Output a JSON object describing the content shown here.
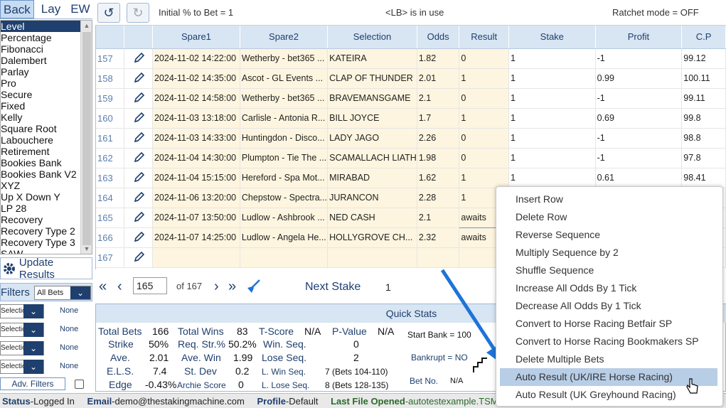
{
  "tabs": {
    "back": "Back",
    "lay": "Lay",
    "ew": "EW"
  },
  "methods": [
    "Level",
    "Percentage",
    "Fibonacci",
    "Dalembert",
    "Parlay",
    "Pro",
    "Secure",
    "Fixed",
    "Kelly",
    "Square Root",
    "Labouchere",
    "Retirement",
    "Bookies Bank",
    "Bookies Bank V2",
    "XYZ",
    "Up X Down Y",
    "LP 28",
    "Recovery",
    "Recovery Type 2",
    "Recovery Type 3",
    "SAW"
  ],
  "update_results": "Update Results",
  "filters": {
    "label": "Filters",
    "select": "All Bets",
    "rows": [
      {
        "sel": "Selection",
        "val": "None"
      },
      {
        "sel": "Selection",
        "val": "None"
      },
      {
        "sel": "Selection",
        "val": "None"
      },
      {
        "sel": "Selection",
        "val": "None"
      }
    ],
    "adv": "Adv. Filters"
  },
  "toolbar": {
    "initial": "Initial % to Bet = 1",
    "lb": "<LB> is in use",
    "ratchet": "Ratchet mode = OFF"
  },
  "grid": {
    "headers": [
      "",
      "",
      "Spare1",
      "Spare2",
      "Selection",
      "Odds",
      "Result",
      "Stake",
      "Profit",
      "C.P"
    ],
    "rows": [
      {
        "n": "157",
        "s1": "2024-11-02 14:22:00",
        "s2": "Wetherby - bet365 ...",
        "sel": "KATEIRA",
        "odds": "1.82",
        "res": "0",
        "stake": "1",
        "profit": "-1",
        "cp": "99.12"
      },
      {
        "n": "158",
        "s1": "2024-11-02 14:35:00",
        "s2": "Ascot - GL Events ...",
        "sel": "CLAP OF THUNDER",
        "odds": "2.01",
        "res": "1",
        "stake": "1",
        "profit": "0.99",
        "cp": "100.11"
      },
      {
        "n": "159",
        "s1": "2024-11-02 14:58:00",
        "s2": "Wetherby - bet365 ...",
        "sel": "BRAVEMANSGAME",
        "odds": "2.1",
        "res": "0",
        "stake": "1",
        "profit": "-1",
        "cp": "99.11"
      },
      {
        "n": "160",
        "s1": "2024-11-03 13:18:00",
        "s2": "Carlisle - Antonia R...",
        "sel": "BILL JOYCE",
        "odds": "1.7",
        "res": "1",
        "stake": "1",
        "profit": "0.69",
        "cp": "99.8"
      },
      {
        "n": "161",
        "s1": "2024-11-03 14:33:00",
        "s2": "Huntingdon - Disco...",
        "sel": "LADY JAGO",
        "odds": "2.26",
        "res": "0",
        "stake": "1",
        "profit": "-1",
        "cp": "98.8"
      },
      {
        "n": "162",
        "s1": "2024-11-04 14:30:00",
        "s2": "Plumpton - Tie The ...",
        "sel": "SCAMALLACH LIATH",
        "odds": "1.98",
        "res": "0",
        "stake": "1",
        "profit": "-1",
        "cp": "97.8"
      },
      {
        "n": "163",
        "s1": "2024-11-04 15:15:00",
        "s2": "Hereford - Spa Mot...",
        "sel": "MIRABAD",
        "odds": "1.62",
        "res": "1",
        "stake": "1",
        "profit": "0.61",
        "cp": "98.41"
      },
      {
        "n": "164",
        "s1": "2024-11-06 13:20:00",
        "s2": "Chepstow - Spectra...",
        "sel": "JURANCON",
        "odds": "2.28",
        "res": "1",
        "stake": "",
        "profit": "",
        "cp": ""
      },
      {
        "n": "165",
        "s1": "2024-11-07 13:50:00",
        "s2": "Ludlow - Ashbrook ...",
        "sel": "NED CASH",
        "odds": "2.1",
        "res": "awaits",
        "stake": "",
        "profit": "",
        "cp": ""
      },
      {
        "n": "166",
        "s1": "2024-11-07 14:25:00",
        "s2": "Ludlow - Angela He...",
        "sel": "HOLLYGROVE CH...",
        "odds": "2.32",
        "res": "awaits",
        "stake": "",
        "profit": "",
        "cp": ""
      },
      {
        "n": "167",
        "s1": "",
        "s2": "",
        "sel": "",
        "odds": "",
        "res": "",
        "stake": "",
        "profit": "",
        "cp": ""
      }
    ]
  },
  "pager": {
    "current": "165",
    "of": "of 167",
    "next_label": "Next Stake",
    "next_value": "1"
  },
  "quick_stats": {
    "title": "Quick Stats",
    "total_bets_l": "Total Bets",
    "total_bets": "166",
    "total_wins_l": "Total Wins",
    "total_wins": "83",
    "tscore_l": "T-Score",
    "tscore": "N/A",
    "pvalue_l": "P-Value",
    "pvalue": "N/A",
    "strike_l": "Strike",
    "strike": "50%",
    "reqstr_l": "Req. Str.%",
    "reqstr": "50.2%",
    "winseq_l": "Win. Seq.",
    "winseq": "0",
    "ave_l": "Ave.",
    "ave": "2.01",
    "avewin_l": "Ave. Win",
    "avewin": "1.99",
    "loseseq_l": "Lose Seq.",
    "loseseq": "2",
    "els_l": "E.L.S.",
    "els": "7.4",
    "stdev_l": "St. Dev",
    "stdev": "0.2",
    "lwinseq_l": "L. Win Seq.",
    "lwinseq": "7 (Bets 104-110)",
    "edge_l": "Edge",
    "edge": "-0.43%",
    "archie_l": "Archie Score",
    "archie": "0",
    "lloseseq_l": "L. Lose Seq.",
    "lloseseq": "8 (Bets 128-135)",
    "startbank": "Start Bank = 100",
    "bankrupt": "Bankrupt = NO",
    "betno_l": "Bet No.",
    "betno": "N/A"
  },
  "status": {
    "status_l": "Status",
    "status": "-Logged In",
    "email_l": "Email",
    "email": "-demo@thestakingmachine.com",
    "profile_l": "Profile",
    "profile": "-Default",
    "file_l": "Last File Opened",
    "file": "-autotestexample.TSM"
  },
  "context_menu": [
    "Insert Row",
    "Delete Row",
    "Reverse Sequence",
    "Multiply Sequence by 2",
    "Shuffle Sequence",
    "Increase All Odds By 1 Tick",
    "Decrease All Odds By 1 Tick",
    "Convert to Horse Racing Betfair SP",
    "Convert to Horse Racing Bookmakers SP",
    "Delete Multiple Bets",
    "Auto Result (UK/IRE Horse Racing)",
    "Auto Result (UK Greyhound Racing)"
  ],
  "colors": {
    "accent": "#1f3f6e",
    "header_bg": "#d8e5f3",
    "cream": "#fdf5df",
    "highlight": "#b8cde6",
    "arrow": "#1e73d8"
  }
}
